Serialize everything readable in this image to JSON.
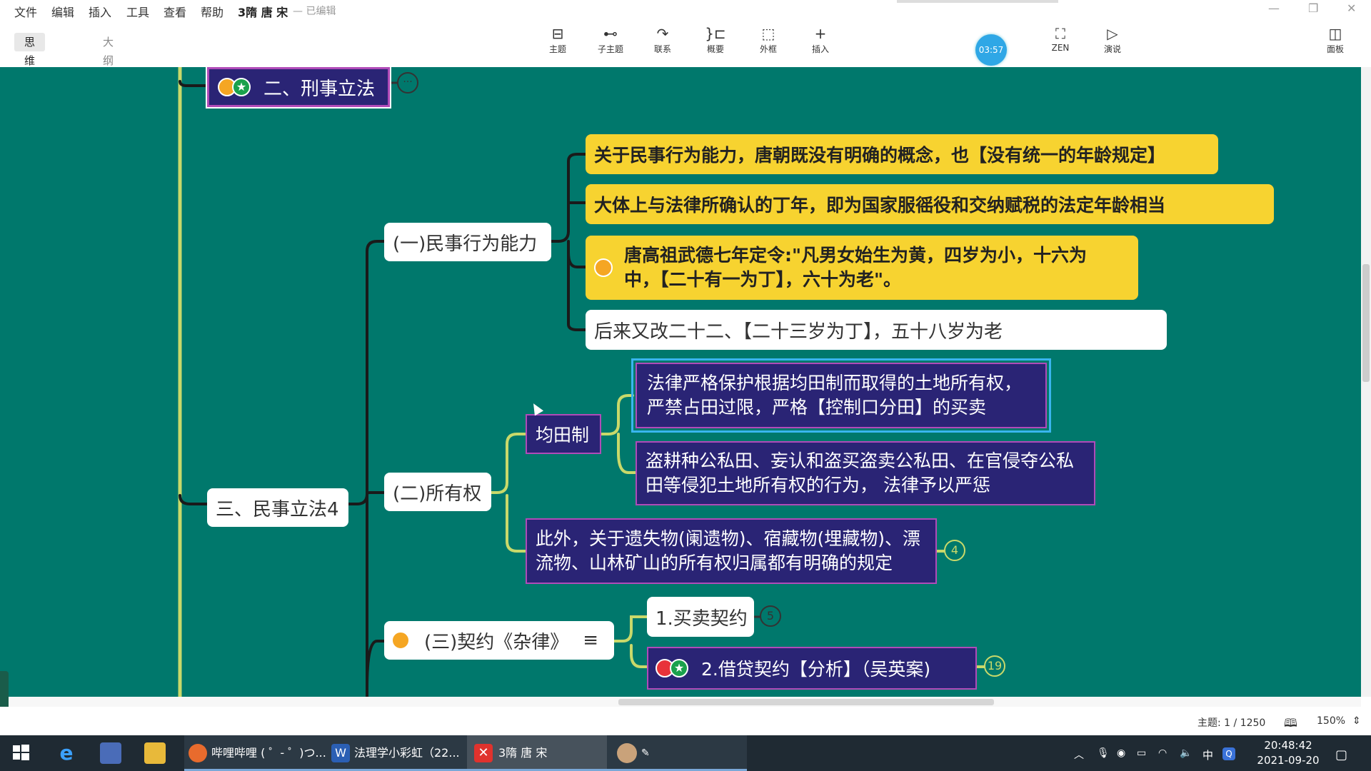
{
  "menu": [
    "文件",
    "编辑",
    "插入",
    "工具",
    "查看",
    "帮助"
  ],
  "document": {
    "title": "3隋 唐 宋",
    "status": "— 已编辑"
  },
  "view_tabs": {
    "mindmap": "思维导图",
    "outline": "大纲"
  },
  "toolbar": {
    "topic": "主题",
    "subtopic": "子主题",
    "relation": "联系",
    "summary": "概要",
    "boundary": "外框",
    "insert": "插入",
    "zen": "ZEN",
    "present": "演说",
    "panel": "面板"
  },
  "timer": "03:57",
  "mindmap": {
    "criminal": "二、刑事立法",
    "civil": "三、民事立法4",
    "capacity": "(一)民事行为能力",
    "cap_1": "关于民事行为能力，唐朝既没有明确的概念，也【没有统一的年龄规定】",
    "cap_2": "大体上与法律所确认的丁年，即为国家服徭役和交纳赋税的法定年龄相当",
    "cap_3": "唐高祖武德七年定令:\"凡男女始生为黄，四岁为小，十六为中，【二十有一为丁】，六十为老\"。",
    "cap_4": "后来又改二十二、【二十三岁为丁】，五十八岁为老",
    "ownership": "(二)所有权",
    "juntian": "均田制",
    "jt_1": "法律严格保护根据均田制而取得的土地所有权，严禁占田过限，严格【控制口分田】的买卖",
    "jt_2": "盗耕种公私田、妄认和盗买盗卖公私田、在官侵夺公私田等侵犯土地所有权的行为， 法律予以严惩",
    "own_other": "此外，关于遗失物(阑遗物)、宿藏物(埋藏物)、漂流物、山林矿山的所有权归属都有明确的规定",
    "own_other_count": "4",
    "contract": "(三)契约《杂律》",
    "sale": "1.买卖契约",
    "sale_count": "5",
    "loan": "2.借贷契约【分析】（吴英案)",
    "loan_count": "19"
  },
  "status": {
    "topics": "主题: 1 / 1250",
    "zoom": "150%"
  },
  "taskbar": {
    "bili": "哔哩哔哩 ( ゜- ゜)つ...",
    "word": "法理学小彩虹（22...",
    "xmind": "3隋 唐 宋",
    "ime": "中",
    "time": "20:48:42",
    "date": "2021-09-20"
  },
  "colors": {
    "canvas": "#00786c",
    "yellow_node": "#f7d330",
    "navy_node": "#2a2475",
    "line": "#1a1a1a",
    "line_light": "#c9d96a"
  }
}
